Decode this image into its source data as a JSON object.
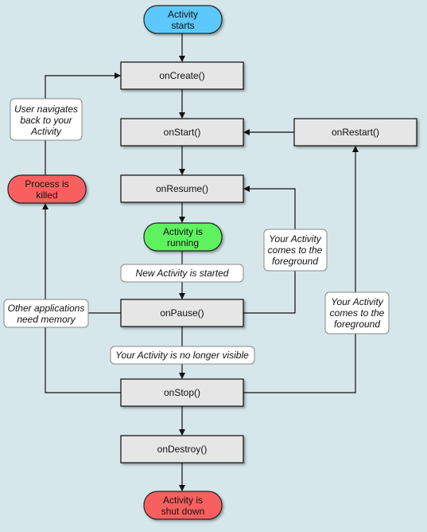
{
  "colors": {
    "background": "#d6e7eb",
    "start": "#5bc8fb",
    "running": "#5ff25f",
    "terminal": "#f86060",
    "callback": "#e6e6e6",
    "note": "#ffffff"
  },
  "states": {
    "start": [
      "Activity",
      "starts"
    ],
    "running": [
      "Activity is",
      "running"
    ],
    "killed": [
      "Process is",
      "killed"
    ],
    "shutdown": [
      "Activity is",
      "shut down"
    ]
  },
  "callbacks": {
    "onCreate": "onCreate()",
    "onStart": "onStart()",
    "onRestart": "onRestart()",
    "onResume": "onResume()",
    "onPause": "onPause()",
    "onStop": "onStop()",
    "onDestroy": "onDestroy()"
  },
  "notes": {
    "navigate_back": [
      "User navigates",
      "back to your",
      "Activity"
    ],
    "new_activity": "New Activity is started",
    "memory": [
      "Other applications",
      "need memory"
    ],
    "foreground1": [
      "Your Activity",
      "comes to the",
      "foreground"
    ],
    "foreground2": [
      "Your Activity",
      "comes to the",
      "foreground"
    ],
    "not_visible": "Your Activity is no longer visible"
  }
}
